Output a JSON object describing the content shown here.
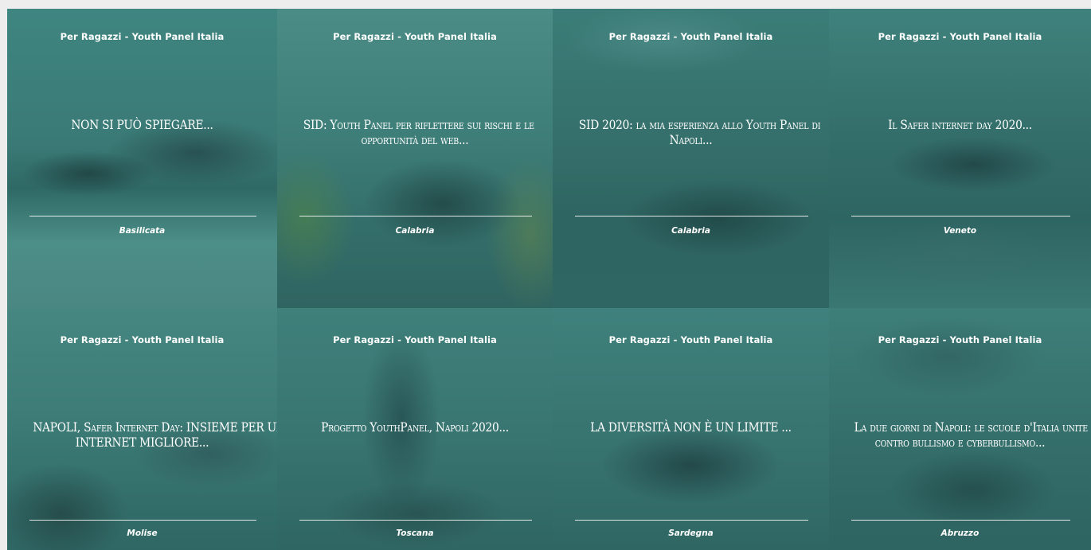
{
  "cards": [
    {
      "source": "Per Ragazzi - Youth Panel Italia",
      "title_line1": "NON SI PUÒ SPIEGARE...",
      "title_line2": "",
      "region": "Basilicata"
    },
    {
      "source": "Per Ragazzi - Youth Panel Italia",
      "title_line1": "SID: Youth Panel per riflettere sui rischi e le",
      "title_line2": "opportunità del web...",
      "region": "Calabria"
    },
    {
      "source": "Per Ragazzi - Youth Panel Italia",
      "title_line1": "SID 2020: la mia esperienza allo Youth Panel di",
      "title_line2": "Napoli...",
      "region": "Calabria"
    },
    {
      "source": "Per Ragazzi - Youth Panel Italia",
      "title_line1": "Il Safer internet day 2020...",
      "title_line2": "",
      "region": "Veneto"
    },
    {
      "source": "Per Ragazzi - Youth Panel Italia",
      "title_line1": "NAPOLI, Safer Internet Day: INSIEME PER UN",
      "title_line2": "INTERNET MIGLIORE...",
      "region": "Molise"
    },
    {
      "source": "Per Ragazzi - Youth Panel Italia",
      "title_line1": "Progetto YouthPanel, Napoli 2020...",
      "title_line2": "",
      "region": "Toscana"
    },
    {
      "source": "Per Ragazzi - Youth Panel Italia",
      "title_line1": "LA DIVERSITÀ NON È UN LIMITE ...",
      "title_line2": "",
      "region": "Sardegna"
    },
    {
      "source": "Per Ragazzi - Youth Panel Italia",
      "title_line1": "La due giorni di Napoli: le scuole d'Italia unite",
      "title_line2": "contro bullismo e cyberbullismo...",
      "region": "Abruzzo"
    }
  ]
}
